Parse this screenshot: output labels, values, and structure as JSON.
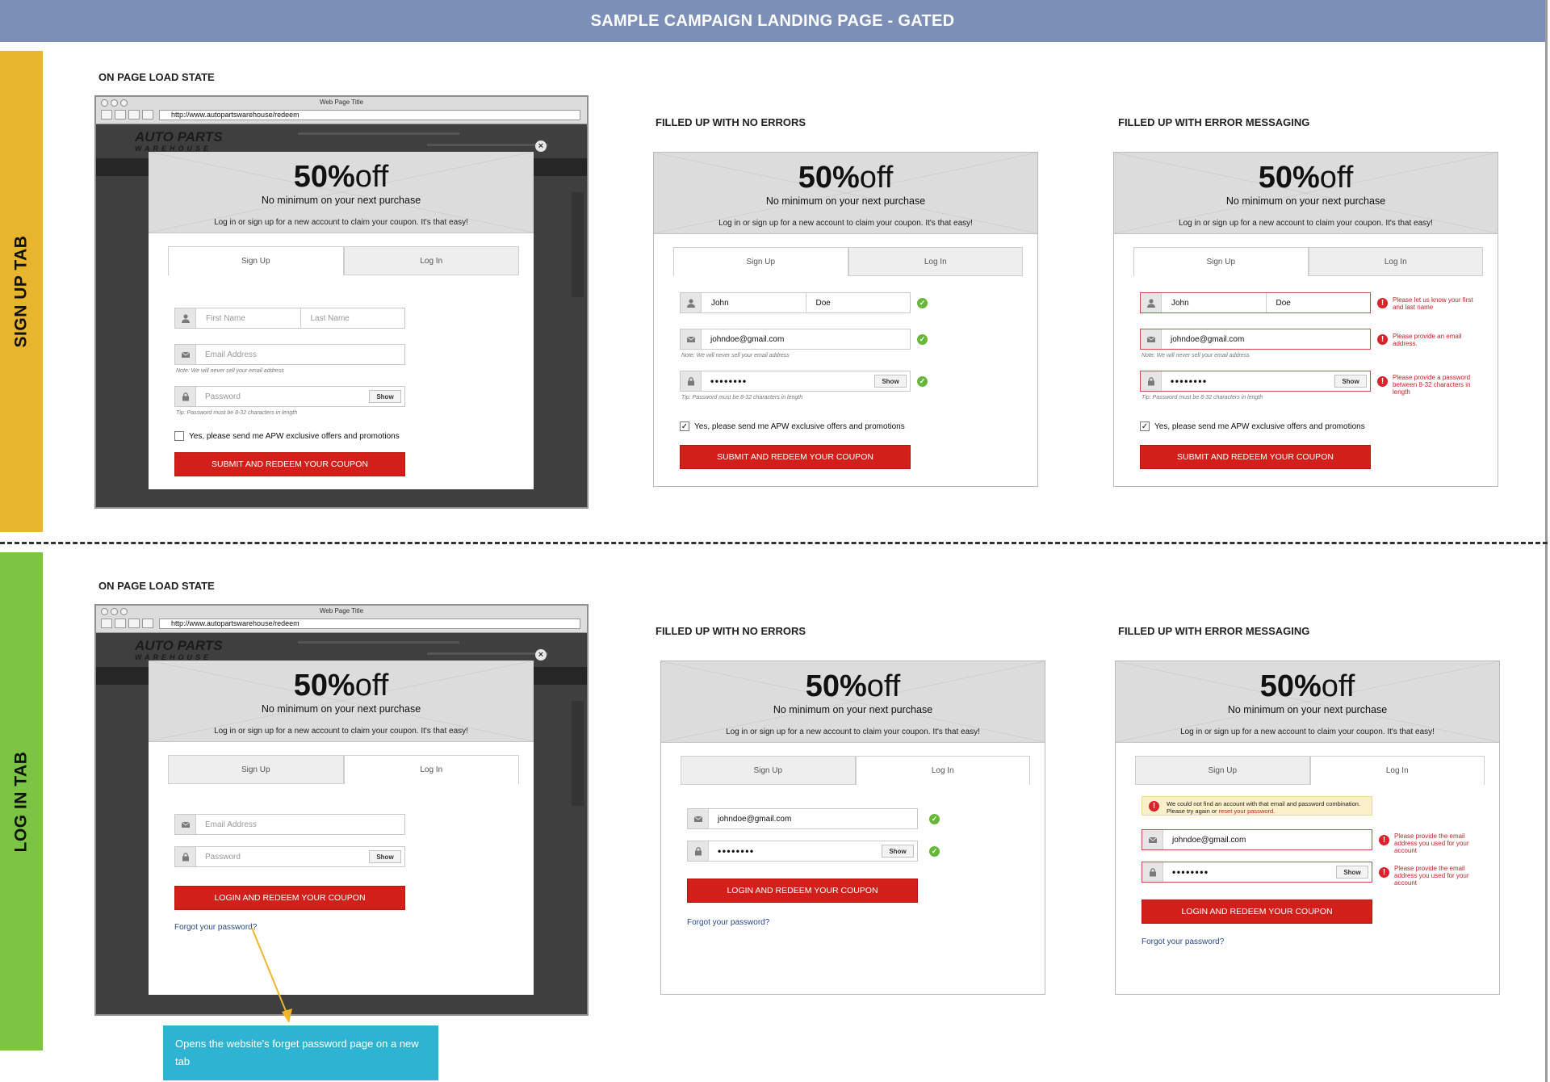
{
  "header": {
    "title": "SAMPLE CAMPAIGN LANDING PAGE - GATED"
  },
  "sections": {
    "signup_tab": "SIGN UP TAB",
    "login_tab": "LOG IN TAB"
  },
  "states": {
    "onload": "ON PAGE LOAD STATE",
    "no_errors": "FILLED UP WITH NO ERRORS",
    "with_errors": "FILLED UP WITH ERROR MESSAGING"
  },
  "browser": {
    "window_title": "Web Page Title",
    "url": "http://www.autopartswarehouse/redeem",
    "logo_line1": "AUTO PARTS",
    "logo_line2": "WAREHOUSE",
    "close": "×"
  },
  "promo": {
    "percent": "50%",
    "off": "off",
    "subtitle": "No minimum on your next purchase",
    "instruction": "Log in or sign up for a new account to claim your coupon.  It's that easy!"
  },
  "tabs": {
    "signup": "Sign Up",
    "login": "Log In"
  },
  "placeholders": {
    "first_name": "First Name",
    "last_name": "Last Name",
    "email": "Email Address",
    "password": "Password"
  },
  "values": {
    "first_name": "John",
    "last_name": "Doe",
    "email": "johndoe@gmail.com",
    "password": "••••••••"
  },
  "labels": {
    "show": "Show",
    "email_note": "Note:  We will never sell your email address",
    "password_tip": "Tip:  Password must be 8-32 characters in length",
    "optin": "Yes, please send me APW exclusive offers and promotions",
    "submit": "SUBMIT AND REDEEM YOUR COUPON",
    "login": "LOGIN AND REDEEM YOUR COUPON",
    "forgot": "Forgot your password?",
    "check": "✓",
    "ok": "✓",
    "error": "!"
  },
  "errors": {
    "name": "Please let us know your first and last name",
    "email": "Please provide an email address.",
    "password": "Please provide a password between 8-32 characters in length",
    "login_banner": "We could not find an account with that email and password combination.  Please try again or",
    "login_banner_link": "reset your password.",
    "login_email": "Please provide the email address you used for your account",
    "login_password": "Please provide the email address you used for your account"
  },
  "annotation": {
    "text": "Opens the website's forget password page on a new tab"
  },
  "colors": {
    "header": "#7b8fb7",
    "signup_sidebar": "#e8b52e",
    "login_sidebar": "#7cc544",
    "cta": "#d21f1a",
    "success": "#67b83a",
    "error": "#d8232a",
    "annotation": "#2fb3d2",
    "arrow": "#f1b52c"
  },
  "icons": {
    "person": "user-icon",
    "email": "envelope-icon",
    "password": "lock-icon",
    "ok": "check-circle-icon",
    "error": "alert-circle-icon"
  }
}
